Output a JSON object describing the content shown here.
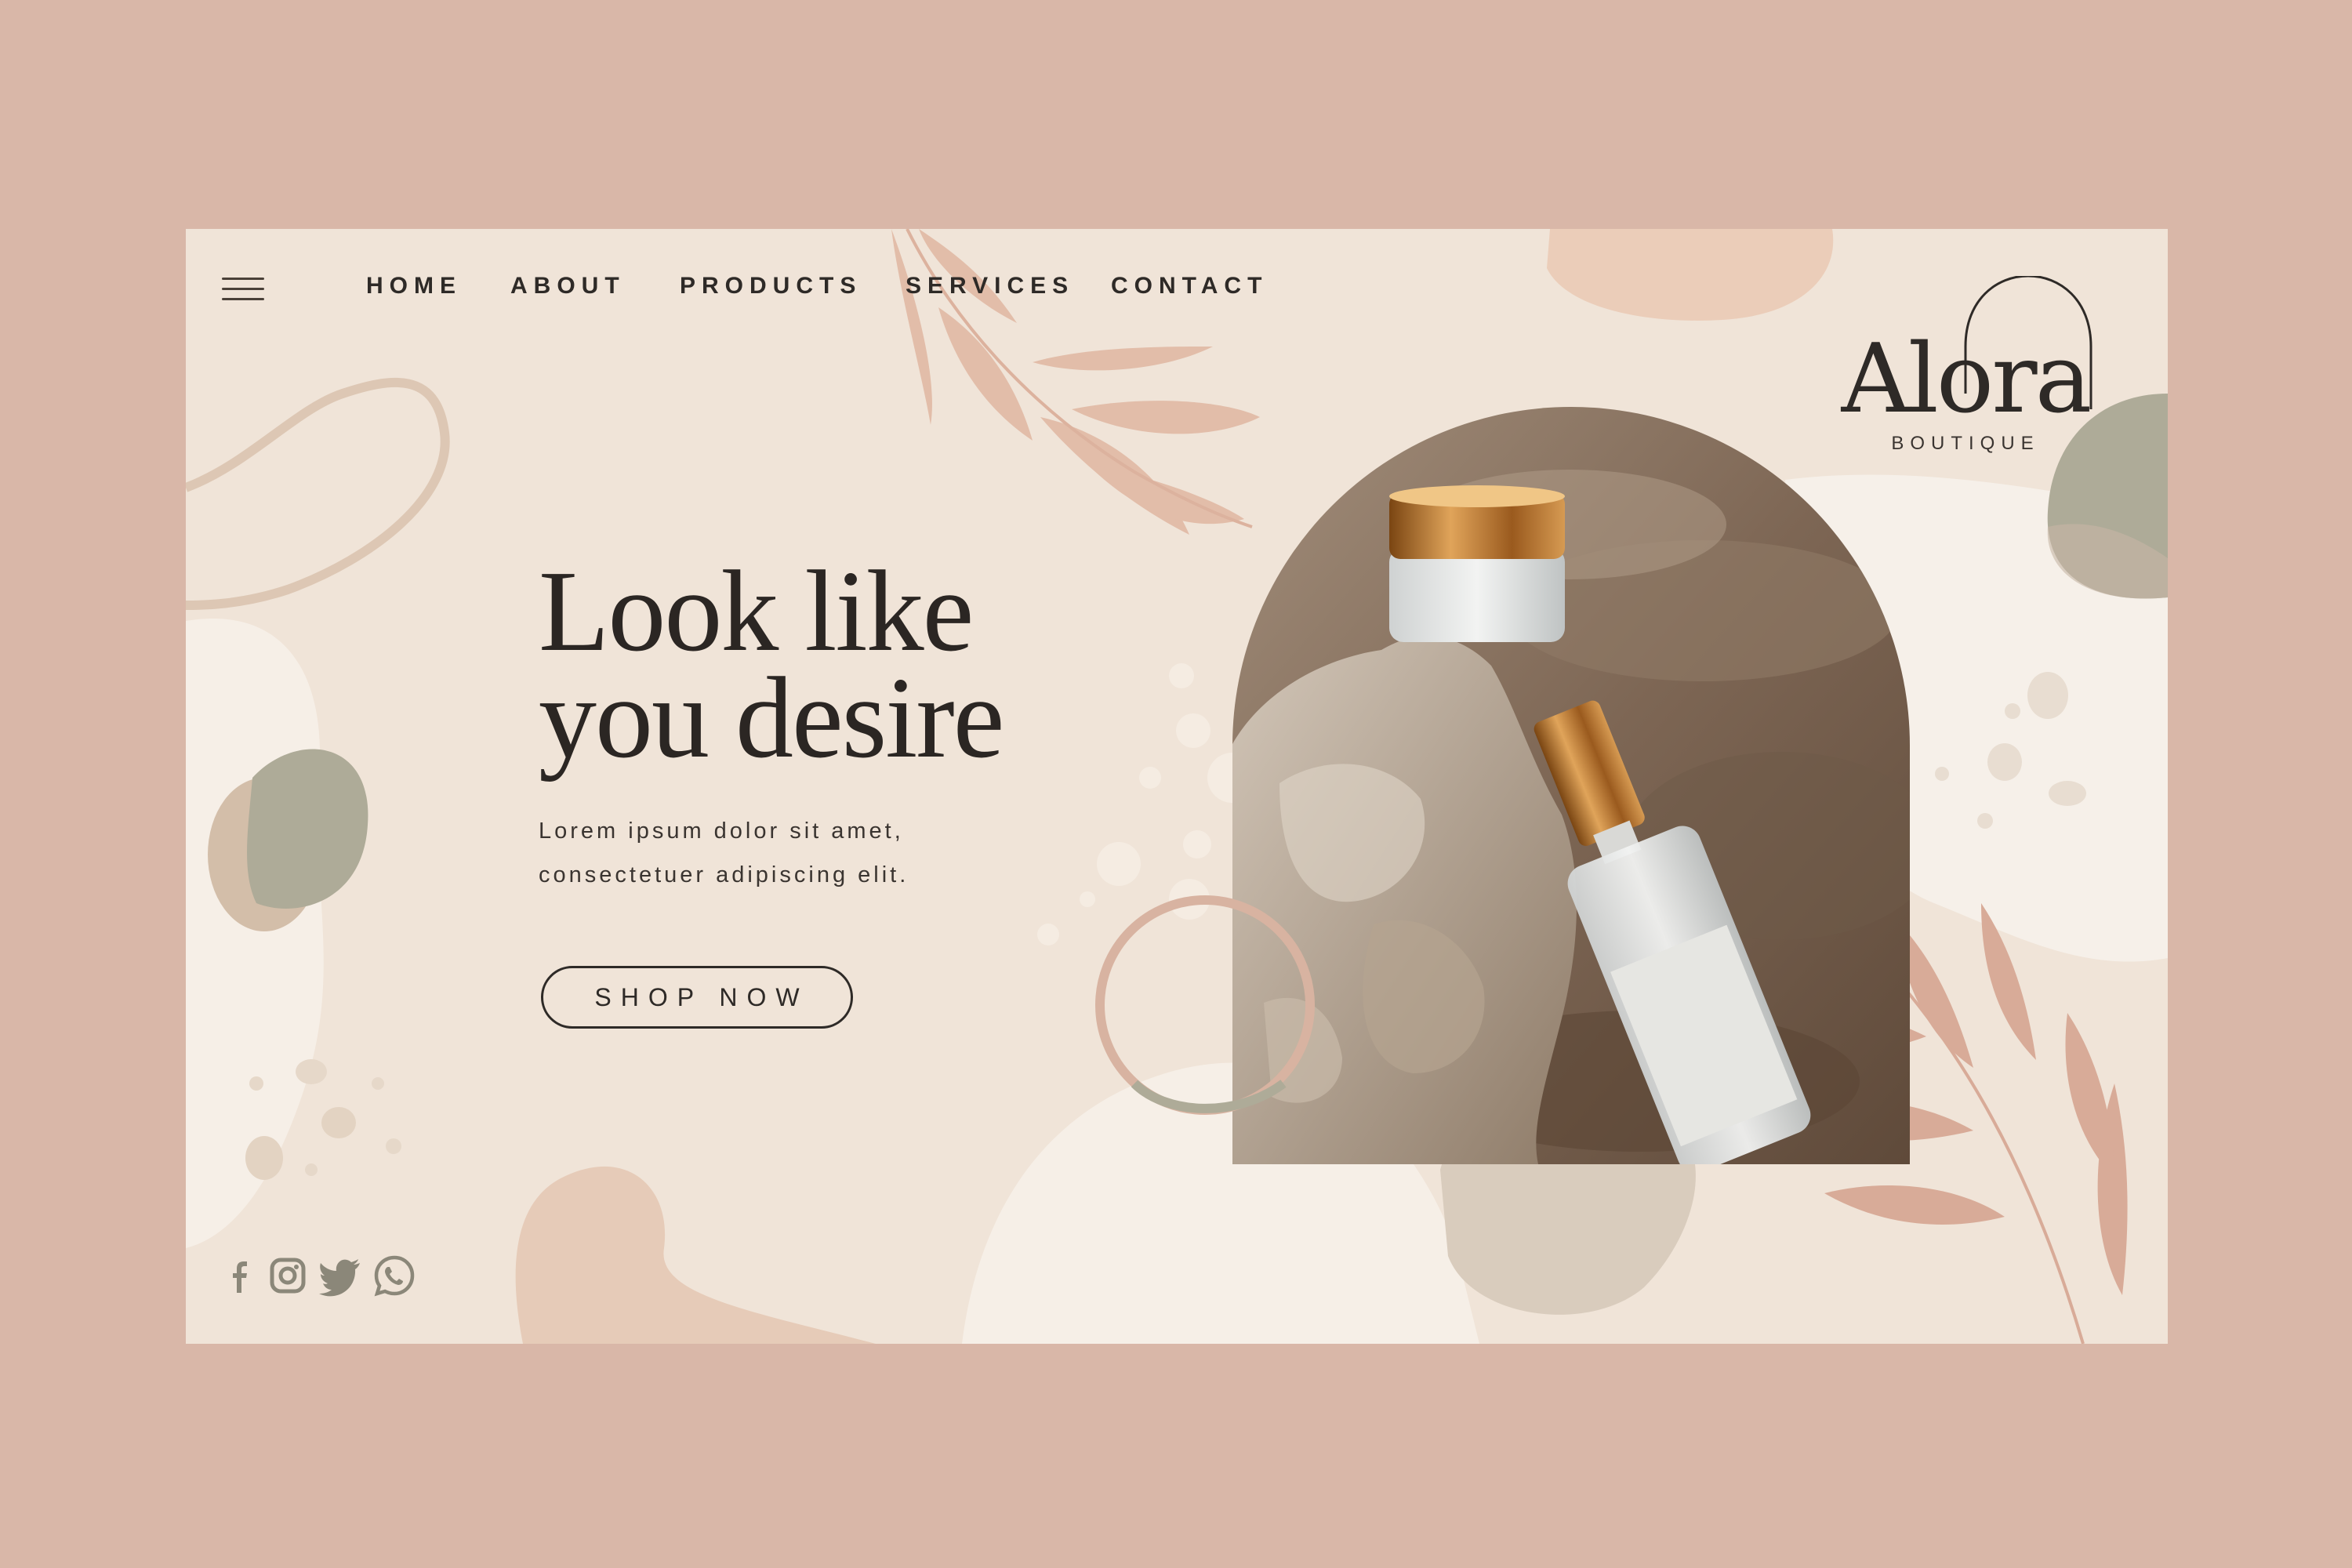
{
  "nav": {
    "items": [
      "HOME",
      "ABOUT",
      "PRODUCTS",
      "SERVICES",
      "CONTACT"
    ]
  },
  "brand": {
    "name": "Alora",
    "tagline": "BOUTIQUE"
  },
  "hero": {
    "headline_line1": "Look like",
    "headline_line2": "you desire",
    "subtext_line1": "Lorem ipsum dolor sit amet,",
    "subtext_line2": "consectetuer adipiscing elit.",
    "cta": "SHOP NOW"
  },
  "socials": [
    "facebook-icon",
    "instagram-icon",
    "twitter-icon",
    "whatsapp-icon"
  ],
  "colors": {
    "frame": "#d9b7a8",
    "card": "#f0e4d8",
    "peach": "#e6c3b0",
    "rose": "#d8ab98",
    "sage": "#aeab98",
    "cream": "#f6f0e9",
    "text": "#2e2a27"
  }
}
